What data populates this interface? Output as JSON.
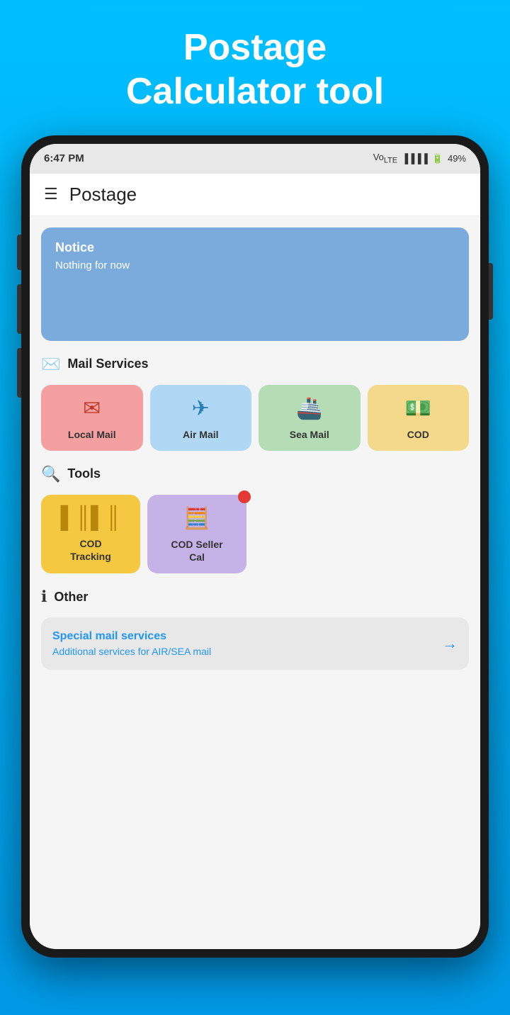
{
  "hero": {
    "title_line1": "Postage",
    "title_line2": "Calculator tool"
  },
  "status_bar": {
    "time": "6:47 PM",
    "signal": "▐▐▐▐",
    "battery": "49%"
  },
  "app_header": {
    "title": "Postage"
  },
  "notice": {
    "title": "Notice",
    "text": "Nothing for now"
  },
  "mail_services": {
    "section_label": "Mail Services",
    "items": [
      {
        "id": "local-mail",
        "label": "Local Mail",
        "color_class": "local"
      },
      {
        "id": "air-mail",
        "label": "Air Mail",
        "color_class": "air"
      },
      {
        "id": "sea-mail",
        "label": "Sea Mail",
        "color_class": "sea"
      },
      {
        "id": "cod",
        "label": "COD",
        "color_class": "cod"
      }
    ]
  },
  "tools": {
    "section_label": "Tools",
    "items": [
      {
        "id": "cod-tracking",
        "label": "COD\nTracking",
        "color_class": "cod-tracking",
        "has_dot": false
      },
      {
        "id": "cod-seller",
        "label": "COD Seller\nCal",
        "color_class": "cod-seller",
        "has_dot": true
      }
    ]
  },
  "other": {
    "section_label": "Other",
    "special_card": {
      "title": "Special mail services",
      "subtitle": "Additional services for AIR/SEA mail"
    }
  }
}
